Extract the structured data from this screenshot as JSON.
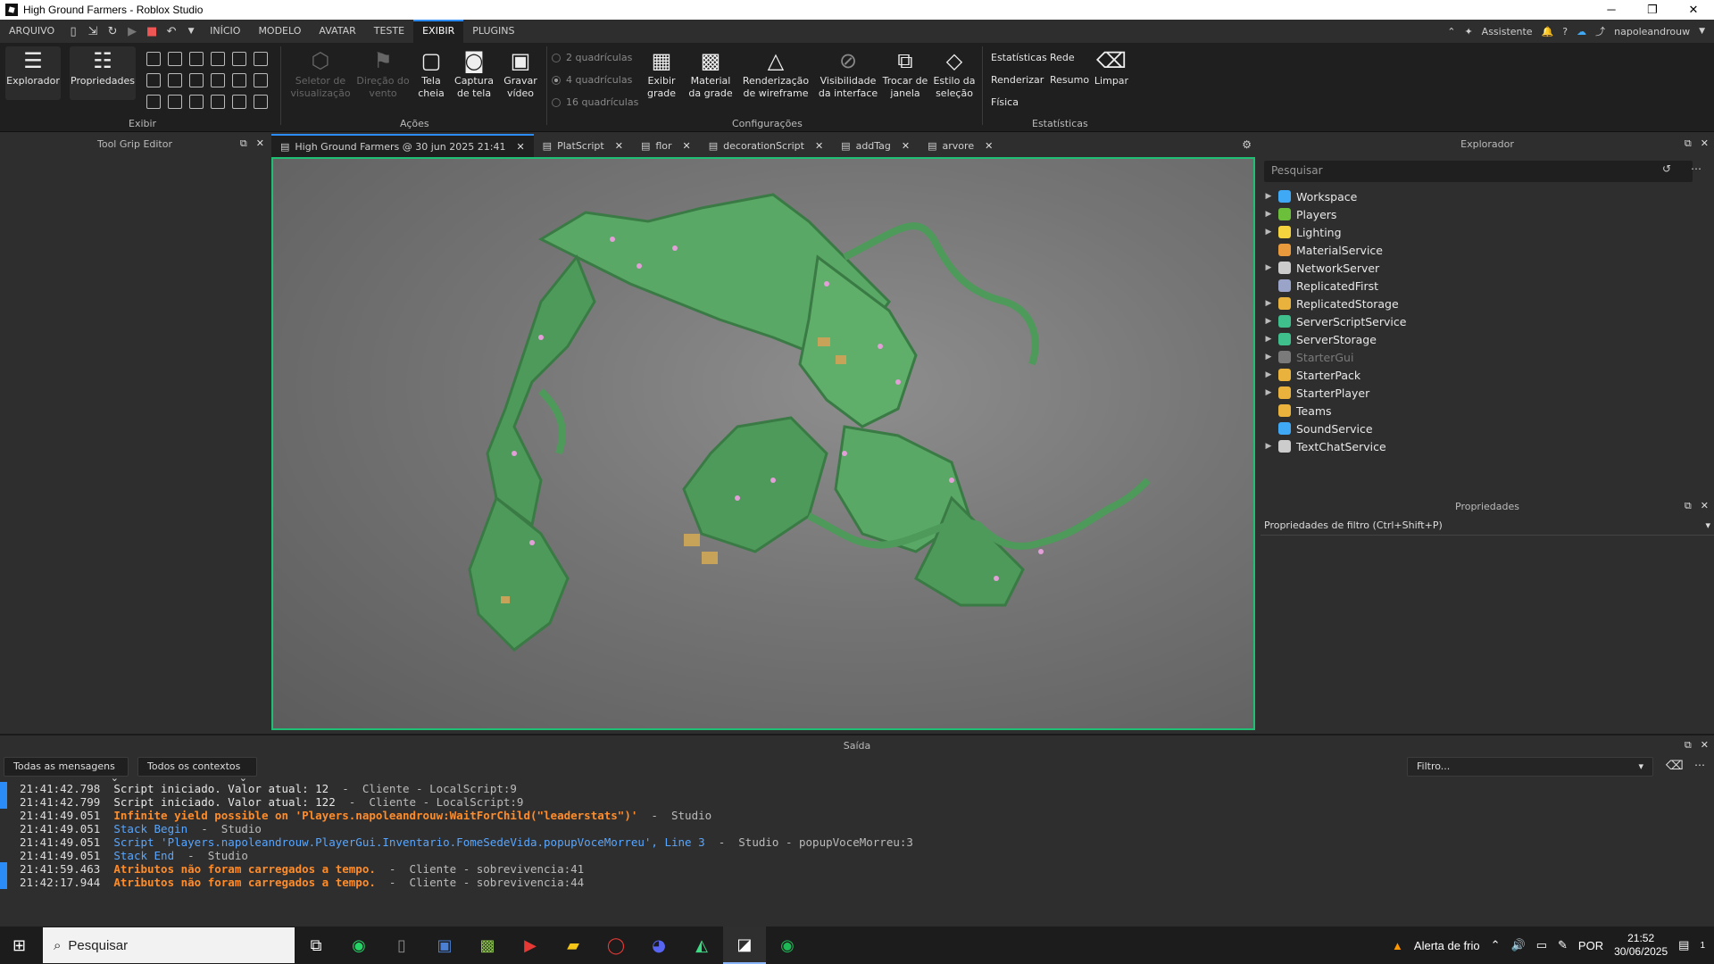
{
  "window": {
    "title": "High Ground Farmers - Roblox Studio",
    "minimize": "─",
    "restore": "❐",
    "close": "✕"
  },
  "menu": {
    "items": [
      "ARQUIVO",
      "INÍCIO",
      "MODELO",
      "AVATAR",
      "TESTE",
      "EXIBIR",
      "PLUGINS"
    ],
    "active": "EXIBIR",
    "assistant": "Assistente",
    "user": "napoleandrouw"
  },
  "ribbon": {
    "explorer": "Explorador",
    "properties": "Propriedades",
    "group_exibir": "Exibir",
    "viewport_selector": "Seletor de visualização",
    "wind_direction": "Direção do vento",
    "fullscreen": "Tela cheia",
    "screenshot": "Captura de tela",
    "record_video": "Gravar vídeo",
    "group_acoes": "Ações",
    "grid_2": "2 quadrículas",
    "grid_4": "4 quadrículas",
    "grid_16": "16 quadrículas",
    "show_grid": "Exibir grade",
    "grid_material": "Material da grade",
    "wireframe": "Renderização de wireframe",
    "ui_visibility": "Visibilidade da interface",
    "switch_window": "Trocar de janela",
    "selection_style": "Estilo da seleção",
    "group_config": "Configurações",
    "stats": "Estatísticas",
    "network": "Rede",
    "render": "Renderizar",
    "summary": "Resumo",
    "physics": "Física",
    "clear": "Limpar",
    "group_stats": "Estatísticas"
  },
  "left_panel": {
    "title": "Tool Grip Editor"
  },
  "tabs": [
    {
      "label": "High Ground Farmers @ 30 jun 2025 21:41",
      "active": true
    },
    {
      "label": "PlatScript"
    },
    {
      "label": "flor"
    },
    {
      "label": "decorationScript"
    },
    {
      "label": "addTag"
    },
    {
      "label": "arvore"
    }
  ],
  "explorer": {
    "title": "Explorador",
    "search_placeholder": "Pesquisar",
    "items": [
      {
        "label": "Workspace",
        "expand": "▶",
        "color": "#3fa9f5"
      },
      {
        "label": "Players",
        "expand": "▶",
        "color": "#6bbf3a"
      },
      {
        "label": "Lighting",
        "expand": "▶",
        "color": "#f5d33f"
      },
      {
        "label": "MaterialService",
        "expand": "",
        "color": "#e89a3c"
      },
      {
        "label": "NetworkServer",
        "expand": "▶",
        "color": "#cccccc"
      },
      {
        "label": "ReplicatedFirst",
        "expand": "",
        "color": "#9aa4c8"
      },
      {
        "label": "ReplicatedStorage",
        "expand": "▶",
        "color": "#e8b23c"
      },
      {
        "label": "ServerScriptService",
        "expand": "▶",
        "color": "#3fbf8c"
      },
      {
        "label": "ServerStorage",
        "expand": "▶",
        "color": "#3fbf8c"
      },
      {
        "label": "StarterGui",
        "expand": "▶",
        "color": "#7a7a7a",
        "dim": true
      },
      {
        "label": "StarterPack",
        "expand": "▶",
        "color": "#e8b23c"
      },
      {
        "label": "StarterPlayer",
        "expand": "▶",
        "color": "#e8b23c"
      },
      {
        "label": "Teams",
        "expand": "",
        "color": "#e8b23c"
      },
      {
        "label": "SoundService",
        "expand": "",
        "color": "#3fa9f5"
      },
      {
        "label": "TextChatService",
        "expand": "▶",
        "color": "#cccccc"
      }
    ]
  },
  "properties": {
    "title": "Propriedades",
    "filter": "Propriedades de filtro (Ctrl+Shift+P)"
  },
  "output": {
    "title": "Saída",
    "msg_filter": "Todas as mensagens",
    "ctx_filter": "Todos os contextos",
    "filter_placeholder": "Filtro...",
    "lines": [
      {
        "time": "21:41:42.798",
        "parts": [
          {
            "text": "Script iniciado. Valor atual: 12",
            "cls": "c-white"
          },
          {
            "text": "  -  Cliente - LocalScript:9",
            "cls": "c-gray"
          }
        ],
        "bar": true
      },
      {
        "time": "21:41:42.799",
        "parts": [
          {
            "text": "Script iniciado. Valor atual: 122",
            "cls": "c-white"
          },
          {
            "text": "  -  Cliente - LocalScript:9",
            "cls": "c-gray"
          }
        ],
        "bar": true
      },
      {
        "time": "21:41:49.051",
        "parts": [
          {
            "text": "Infinite yield possible on 'Players.napoleandrouw:WaitForChild(\"leaderstats\")'",
            "cls": "c-orange"
          },
          {
            "text": "  -  Studio",
            "cls": "c-gray"
          }
        ],
        "bar": false
      },
      {
        "time": "21:41:49.051",
        "parts": [
          {
            "text": "Stack Begin",
            "cls": "c-blue"
          },
          {
            "text": "  -  Studio",
            "cls": "c-gray"
          }
        ],
        "bar": false
      },
      {
        "time": "21:41:49.051",
        "parts": [
          {
            "text": "Script 'Players.napoleandrouw.PlayerGui.Inventario.FomeSedeVida.popupVoceMorreu', Line 3",
            "cls": "c-blue"
          },
          {
            "text": "  -  Studio - popupVoceMorreu:3",
            "cls": "c-gray"
          }
        ],
        "bar": false
      },
      {
        "time": "21:41:49.051",
        "parts": [
          {
            "text": "Stack End",
            "cls": "c-blue"
          },
          {
            "text": "  -  Studio",
            "cls": "c-gray"
          }
        ],
        "bar": false
      },
      {
        "time": "21:41:59.463",
        "parts": [
          {
            "text": "Atributos não foram carregados a tempo.",
            "cls": "c-orange"
          },
          {
            "text": "  -  Cliente - sobrevivencia:41",
            "cls": "c-gray"
          }
        ],
        "bar": true
      },
      {
        "time": "21:42:17.944",
        "parts": [
          {
            "text": "Atributos não foram carregados a tempo.",
            "cls": "c-orange"
          },
          {
            "text": "  -  Cliente - sobrevivencia:44",
            "cls": "c-gray"
          }
        ],
        "bar": true
      }
    ]
  },
  "taskbar": {
    "search": "Pesquisar",
    "weather": "Alerta de frio",
    "lang": "POR",
    "time": "21:52",
    "date": "30/06/2025",
    "notif": "1"
  }
}
